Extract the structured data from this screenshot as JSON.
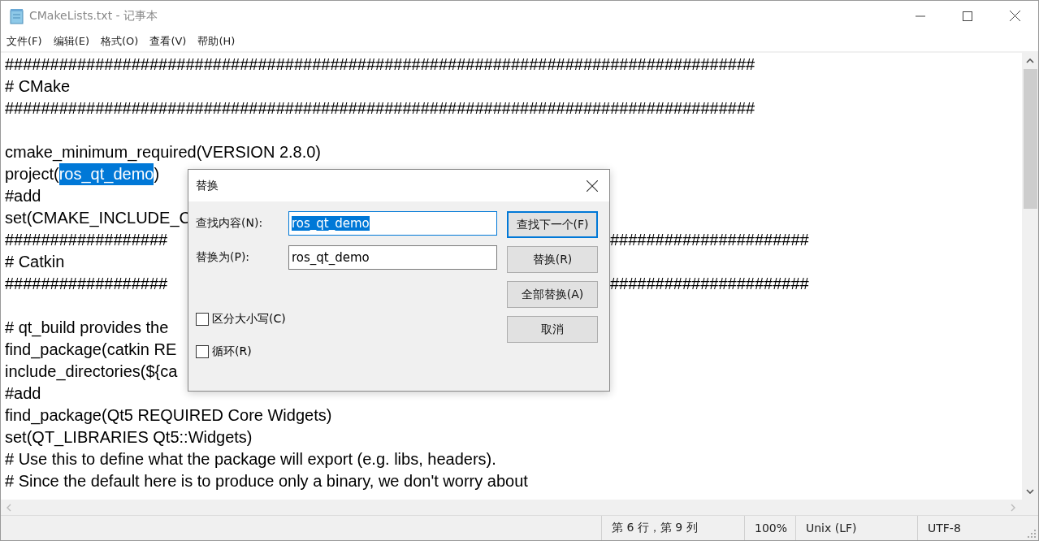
{
  "window": {
    "title": "CMakeLists.txt - 记事本"
  },
  "menu": [
    "文件(F)",
    "编辑(E)",
    "格式(O)",
    "查看(V)",
    "帮助(H)"
  ],
  "lines": [
    {
      "kind": "code",
      "segments": [
        {
          "text": "###################################################################################",
          "selected": false
        }
      ]
    },
    {
      "kind": "code",
      "segments": [
        {
          "text": "# CMake",
          "selected": false
        }
      ]
    },
    {
      "kind": "code",
      "segments": [
        {
          "text": "###################################################################################",
          "selected": false
        }
      ]
    },
    {
      "kind": "blank"
    },
    {
      "kind": "code",
      "segments": [
        {
          "text": "cmake_minimum_required(VERSION 2.8.0)",
          "selected": false
        }
      ]
    },
    {
      "kind": "code",
      "segments": [
        {
          "text": "project(",
          "selected": false
        },
        {
          "text": "ros_qt_demo",
          "selected": true
        },
        {
          "text": ")",
          "selected": false
        }
      ]
    },
    {
      "kind": "code",
      "segments": [
        {
          "text": "#add",
          "selected": false
        }
      ]
    },
    {
      "kind": "code",
      "segments": [
        {
          "text": "set(CMAKE_INCLUDE_C",
          "selected": false
        }
      ]
    },
    {
      "kind": "code",
      "segments": [
        {
          "text": "##################",
          "selected": false
        }
      ],
      "right_text": "######################"
    },
    {
      "kind": "code",
      "segments": [
        {
          "text": "# Catkin",
          "selected": false
        }
      ]
    },
    {
      "kind": "code",
      "segments": [
        {
          "text": "##################",
          "selected": false
        }
      ],
      "right_text": "######################"
    },
    {
      "kind": "blank"
    },
    {
      "kind": "code",
      "segments": [
        {
          "text": "# qt_build provides the",
          "selected": false
        }
      ]
    },
    {
      "kind": "code",
      "segments": [
        {
          "text": "find_package(catkin RE",
          "selected": false
        }
      ]
    },
    {
      "kind": "code",
      "segments": [
        {
          "text": "include_directories(${ca",
          "selected": false
        }
      ]
    },
    {
      "kind": "code",
      "segments": [
        {
          "text": "#add",
          "selected": false
        }
      ]
    },
    {
      "kind": "code",
      "segments": [
        {
          "text": "find_package(Qt5 REQUIRED Core Widgets)",
          "selected": false
        }
      ]
    },
    {
      "kind": "code",
      "segments": [
        {
          "text": "set(QT_LIBRARIES Qt5::Widgets)",
          "selected": false
        }
      ]
    },
    {
      "kind": "code",
      "segments": [
        {
          "text": "# Use this to define what the package will export (e.g. libs, headers).",
          "selected": false
        }
      ]
    },
    {
      "kind": "code",
      "segments": [
        {
          "text": "# Since the default here is to produce only a binary, we don't worry about",
          "selected": false
        }
      ]
    }
  ],
  "dialog": {
    "title": "替换",
    "find": {
      "label": "查找内容(N):",
      "value": "ros_qt_demo",
      "selected": true
    },
    "replace": {
      "label": "替换为(P):",
      "value": "ros_qt_demo",
      "selected": false
    },
    "buttons": [
      {
        "label": "查找下一个(F)",
        "default": true
      },
      {
        "label": "替换(R)",
        "default": false
      },
      {
        "label": "全部替换(A)",
        "default": false
      },
      {
        "label": "取消",
        "default": false
      }
    ],
    "options": [
      {
        "label": "区分大小写(C)",
        "checked": false
      },
      {
        "label": "循环(R)",
        "checked": false
      }
    ]
  },
  "status_bar": [
    "第 6 行，第 9 列",
    "100%",
    "Unix (LF)",
    "UTF-8"
  ]
}
